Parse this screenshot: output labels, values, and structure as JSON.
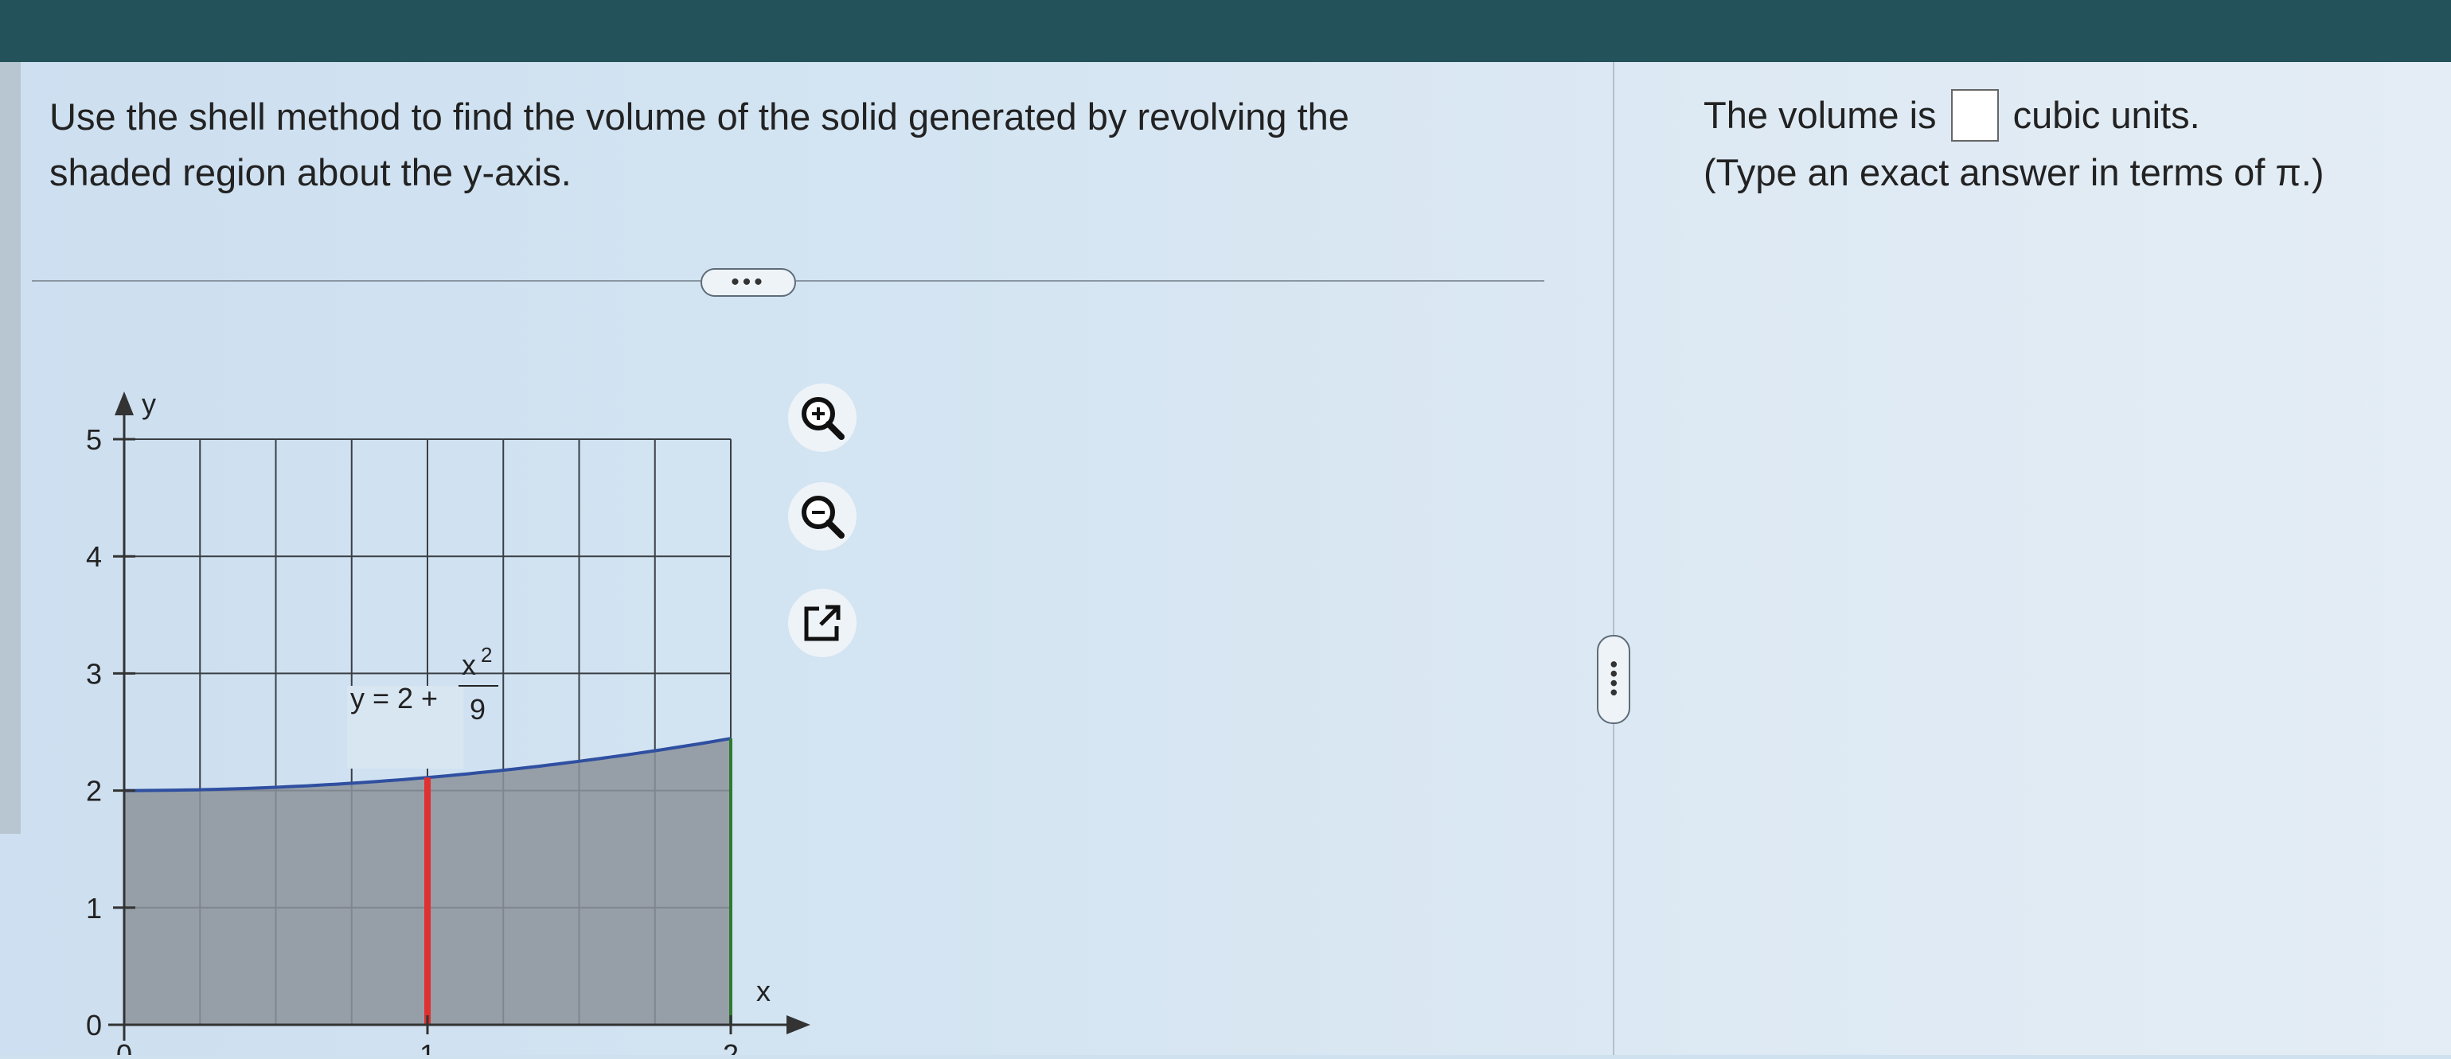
{
  "question": {
    "line1": "Use the shell method to find the volume of the solid generated by revolving the",
    "line2": "shaded region about the y-axis."
  },
  "answer": {
    "prefix": "The volume is",
    "suffix": "cubic units.",
    "hint": "(Type an exact answer in terms of π.)",
    "value": ""
  },
  "divider": {
    "more_label": "•••"
  },
  "side_handle": {
    "label": "••••"
  },
  "tools": {
    "zoom_in": "magnifier-plus-icon",
    "zoom_out": "magnifier-minus-icon",
    "open_new": "external-link-icon"
  },
  "graph": {
    "y_axis_label": "y",
    "x_axis_label": "x",
    "y_ticks": [
      "0",
      "1",
      "2",
      "3",
      "4",
      "5"
    ],
    "x_ticks": [
      "0",
      "1",
      "2"
    ],
    "curve_label": {
      "lhs": "y = 2 +",
      "numerator": "x",
      "exponent": "2",
      "denominator": "9"
    },
    "curve_color": "#2f4fa0",
    "shade_color": "#8c939b",
    "strip_color": "#e03030",
    "right_edge_color": "#2f7a2f"
  },
  "chart_data": {
    "type": "area",
    "x_range": [
      0,
      2
    ],
    "ylim": [
      0,
      5
    ],
    "curve": "y = 2 + x^2/9",
    "strip_x": 1,
    "grid": true
  }
}
